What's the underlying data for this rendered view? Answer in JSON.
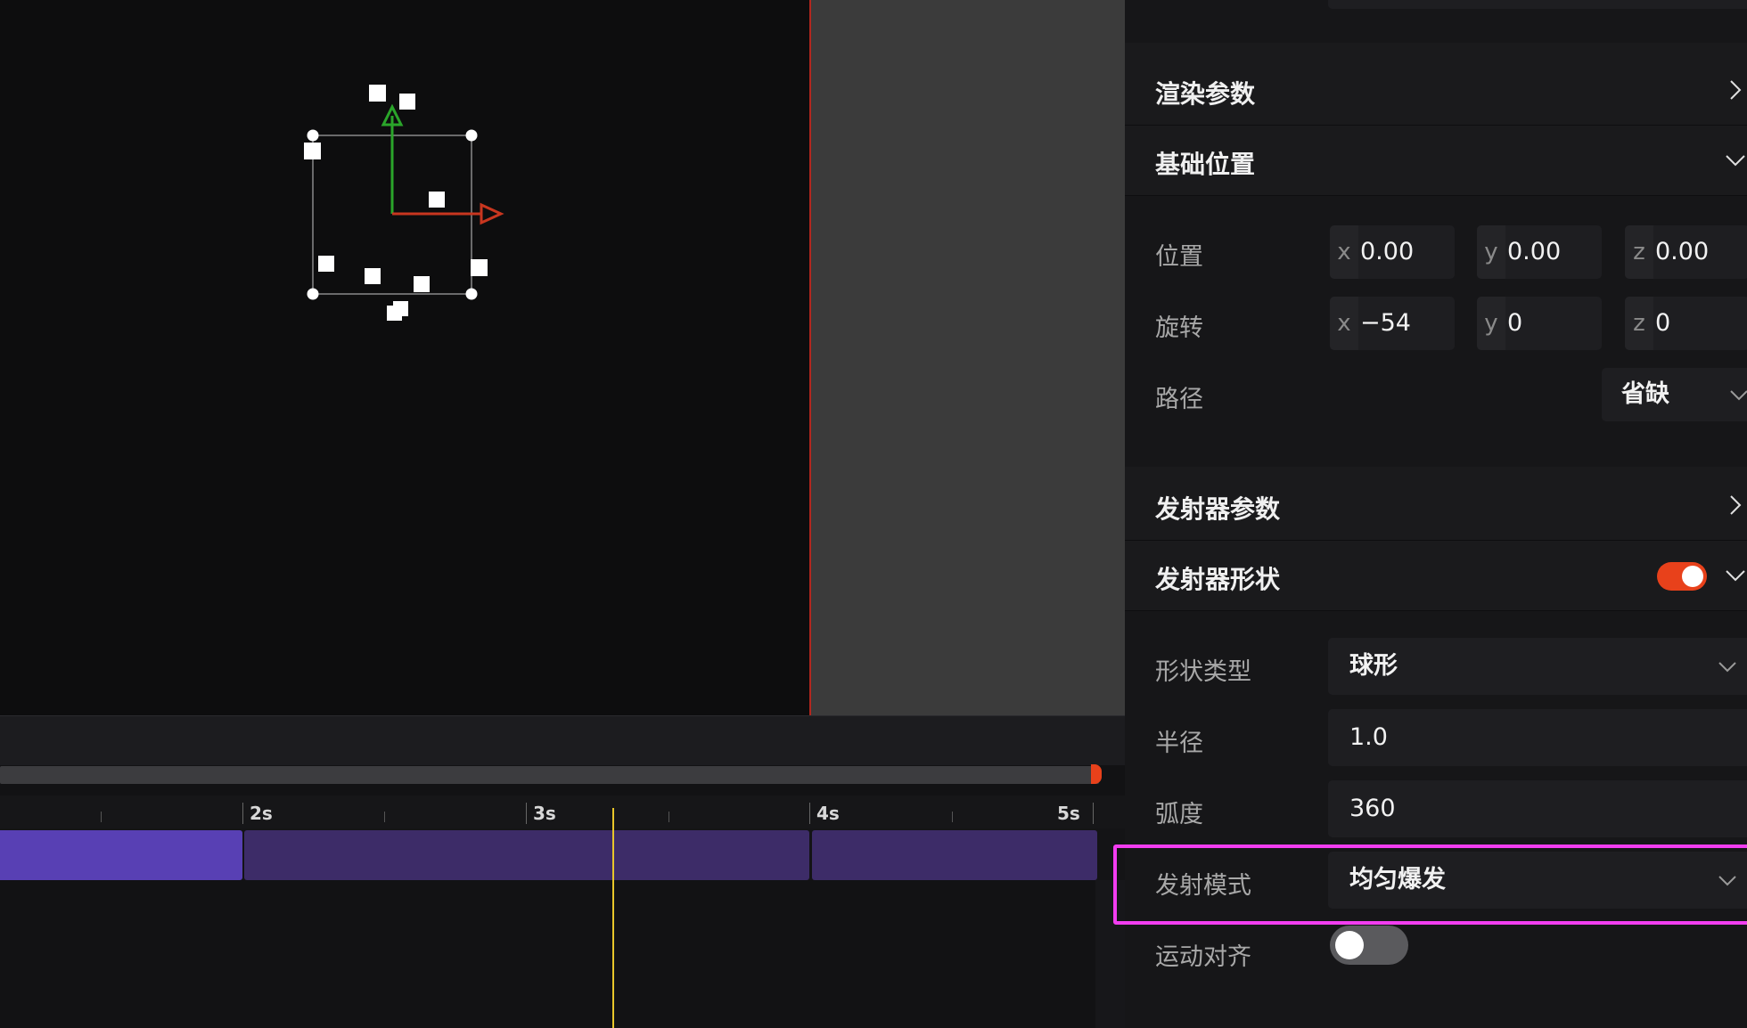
{
  "timeline": {
    "ruler_labels": [
      "2s",
      "3s",
      "4s",
      "5s"
    ]
  },
  "panel": {
    "sections": {
      "render_params": {
        "title": "渲染参数",
        "expanded": false
      },
      "base_position": {
        "title": "基础位置",
        "expanded": true,
        "position_label": "位置",
        "rotation_label": "旋转",
        "path_label": "路径",
        "position": {
          "x": "0.00",
          "y": "0.00",
          "z": "0.00"
        },
        "rotation": {
          "x": "−54",
          "y": "0",
          "z": "0"
        },
        "axis_tags": {
          "x": "x",
          "y": "y",
          "z": "z"
        },
        "path_value": "省缺"
      },
      "emitter_params": {
        "title": "发射器参数",
        "expanded": false
      },
      "emitter_shape": {
        "title": "发射器形状",
        "expanded": true,
        "enabled": true,
        "shape_type_label": "形状类型",
        "shape_type_value": "球形",
        "radius_label": "半径",
        "radius_value": "1.0",
        "arc_label": "弧度",
        "arc_value": "360",
        "emit_mode_label": "发射模式",
        "emit_mode_value": "均匀爆发",
        "motion_align_label": "运动对齐",
        "motion_align_enabled": false
      }
    }
  },
  "colors": {
    "accent_toggle": "#e8411b",
    "highlight": "#f23df0",
    "playhead": "#e8c62a",
    "clip_active": "#5840b4",
    "clip": "#3d2c68",
    "gizmo_x": "#c8361f",
    "gizmo_y": "#2aa52a"
  },
  "icons": {
    "collapsed": "chevron-right-icon",
    "expanded": "chevron-down-icon"
  }
}
